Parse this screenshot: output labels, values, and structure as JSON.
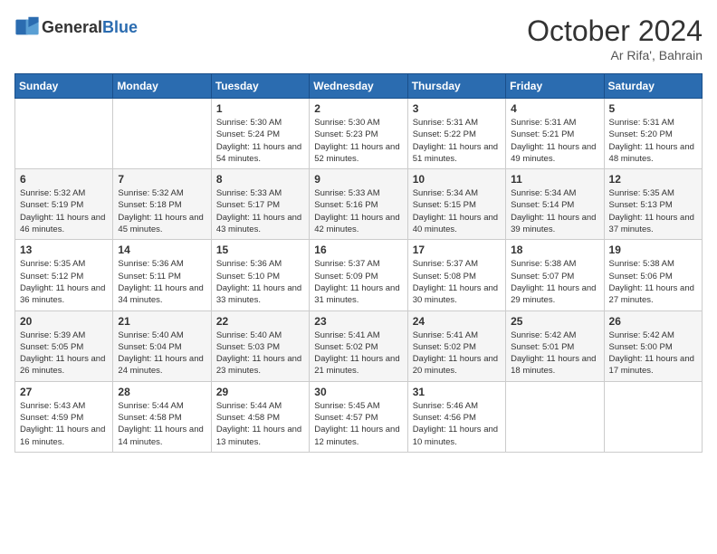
{
  "header": {
    "logo_general": "General",
    "logo_blue": "Blue",
    "month_year": "October 2024",
    "location": "Ar Rifa', Bahrain"
  },
  "weekdays": [
    "Sunday",
    "Monday",
    "Tuesday",
    "Wednesday",
    "Thursday",
    "Friday",
    "Saturday"
  ],
  "weeks": [
    [
      {
        "day": "",
        "info": ""
      },
      {
        "day": "",
        "info": ""
      },
      {
        "day": "1",
        "info": "Sunrise: 5:30 AM\nSunset: 5:24 PM\nDaylight: 11 hours and 54 minutes."
      },
      {
        "day": "2",
        "info": "Sunrise: 5:30 AM\nSunset: 5:23 PM\nDaylight: 11 hours and 52 minutes."
      },
      {
        "day": "3",
        "info": "Sunrise: 5:31 AM\nSunset: 5:22 PM\nDaylight: 11 hours and 51 minutes."
      },
      {
        "day": "4",
        "info": "Sunrise: 5:31 AM\nSunset: 5:21 PM\nDaylight: 11 hours and 49 minutes."
      },
      {
        "day": "5",
        "info": "Sunrise: 5:31 AM\nSunset: 5:20 PM\nDaylight: 11 hours and 48 minutes."
      }
    ],
    [
      {
        "day": "6",
        "info": "Sunrise: 5:32 AM\nSunset: 5:19 PM\nDaylight: 11 hours and 46 minutes."
      },
      {
        "day": "7",
        "info": "Sunrise: 5:32 AM\nSunset: 5:18 PM\nDaylight: 11 hours and 45 minutes."
      },
      {
        "day": "8",
        "info": "Sunrise: 5:33 AM\nSunset: 5:17 PM\nDaylight: 11 hours and 43 minutes."
      },
      {
        "day": "9",
        "info": "Sunrise: 5:33 AM\nSunset: 5:16 PM\nDaylight: 11 hours and 42 minutes."
      },
      {
        "day": "10",
        "info": "Sunrise: 5:34 AM\nSunset: 5:15 PM\nDaylight: 11 hours and 40 minutes."
      },
      {
        "day": "11",
        "info": "Sunrise: 5:34 AM\nSunset: 5:14 PM\nDaylight: 11 hours and 39 minutes."
      },
      {
        "day": "12",
        "info": "Sunrise: 5:35 AM\nSunset: 5:13 PM\nDaylight: 11 hours and 37 minutes."
      }
    ],
    [
      {
        "day": "13",
        "info": "Sunrise: 5:35 AM\nSunset: 5:12 PM\nDaylight: 11 hours and 36 minutes."
      },
      {
        "day": "14",
        "info": "Sunrise: 5:36 AM\nSunset: 5:11 PM\nDaylight: 11 hours and 34 minutes."
      },
      {
        "day": "15",
        "info": "Sunrise: 5:36 AM\nSunset: 5:10 PM\nDaylight: 11 hours and 33 minutes."
      },
      {
        "day": "16",
        "info": "Sunrise: 5:37 AM\nSunset: 5:09 PM\nDaylight: 11 hours and 31 minutes."
      },
      {
        "day": "17",
        "info": "Sunrise: 5:37 AM\nSunset: 5:08 PM\nDaylight: 11 hours and 30 minutes."
      },
      {
        "day": "18",
        "info": "Sunrise: 5:38 AM\nSunset: 5:07 PM\nDaylight: 11 hours and 29 minutes."
      },
      {
        "day": "19",
        "info": "Sunrise: 5:38 AM\nSunset: 5:06 PM\nDaylight: 11 hours and 27 minutes."
      }
    ],
    [
      {
        "day": "20",
        "info": "Sunrise: 5:39 AM\nSunset: 5:05 PM\nDaylight: 11 hours and 26 minutes."
      },
      {
        "day": "21",
        "info": "Sunrise: 5:40 AM\nSunset: 5:04 PM\nDaylight: 11 hours and 24 minutes."
      },
      {
        "day": "22",
        "info": "Sunrise: 5:40 AM\nSunset: 5:03 PM\nDaylight: 11 hours and 23 minutes."
      },
      {
        "day": "23",
        "info": "Sunrise: 5:41 AM\nSunset: 5:02 PM\nDaylight: 11 hours and 21 minutes."
      },
      {
        "day": "24",
        "info": "Sunrise: 5:41 AM\nSunset: 5:02 PM\nDaylight: 11 hours and 20 minutes."
      },
      {
        "day": "25",
        "info": "Sunrise: 5:42 AM\nSunset: 5:01 PM\nDaylight: 11 hours and 18 minutes."
      },
      {
        "day": "26",
        "info": "Sunrise: 5:42 AM\nSunset: 5:00 PM\nDaylight: 11 hours and 17 minutes."
      }
    ],
    [
      {
        "day": "27",
        "info": "Sunrise: 5:43 AM\nSunset: 4:59 PM\nDaylight: 11 hours and 16 minutes."
      },
      {
        "day": "28",
        "info": "Sunrise: 5:44 AM\nSunset: 4:58 PM\nDaylight: 11 hours and 14 minutes."
      },
      {
        "day": "29",
        "info": "Sunrise: 5:44 AM\nSunset: 4:58 PM\nDaylight: 11 hours and 13 minutes."
      },
      {
        "day": "30",
        "info": "Sunrise: 5:45 AM\nSunset: 4:57 PM\nDaylight: 11 hours and 12 minutes."
      },
      {
        "day": "31",
        "info": "Sunrise: 5:46 AM\nSunset: 4:56 PM\nDaylight: 11 hours and 10 minutes."
      },
      {
        "day": "",
        "info": ""
      },
      {
        "day": "",
        "info": ""
      }
    ]
  ]
}
